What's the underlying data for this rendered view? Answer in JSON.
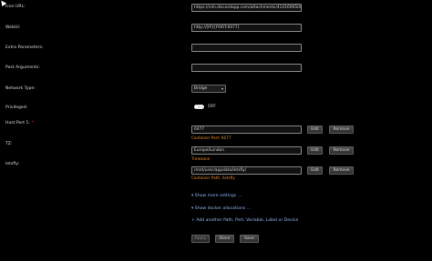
{
  "rows": {
    "icon_url": {
      "label": "Icon URL:",
      "value": "https://cdn.discordapp.com/attachments/414169650054488"
    },
    "webui": {
      "label": "WebUI:",
      "value": "http://[IP]:[PORT:6077]"
    },
    "extra_params": {
      "label": "Extra Parameters:",
      "value": ""
    },
    "post_args": {
      "label": "Post Arguments:",
      "value": ""
    },
    "network_type": {
      "label": "Network Type:",
      "value": "Bridge"
    },
    "privileged": {
      "label": "Privileged:",
      "state": "OFF"
    },
    "host_port": {
      "label": "Host Port 1:",
      "required_mark": "*",
      "value": "6077",
      "hint": "Container Port: 6077"
    },
    "tz": {
      "label": "TZ:",
      "value": "Europe/London",
      "hint": "Timezone"
    },
    "letsfly": {
      "label": "letsfly:",
      "value": "/mnt/user/appdata/letsfly/",
      "hint": "Container Path: /letsfly"
    }
  },
  "buttons": {
    "edit": "Edit",
    "remove": "Remove"
  },
  "links": {
    "more_settings": "Show more settings ...",
    "docker_alloc": "Show docker allocations ...",
    "add_another": "Add another Path, Port, Variable, Label or Device"
  },
  "footer": {
    "apply": "Apply",
    "done": "Done",
    "save": "Save"
  },
  "colors": {
    "hint": "#f08a24",
    "link": "#8fb6ef",
    "required": "#e03a3a"
  }
}
